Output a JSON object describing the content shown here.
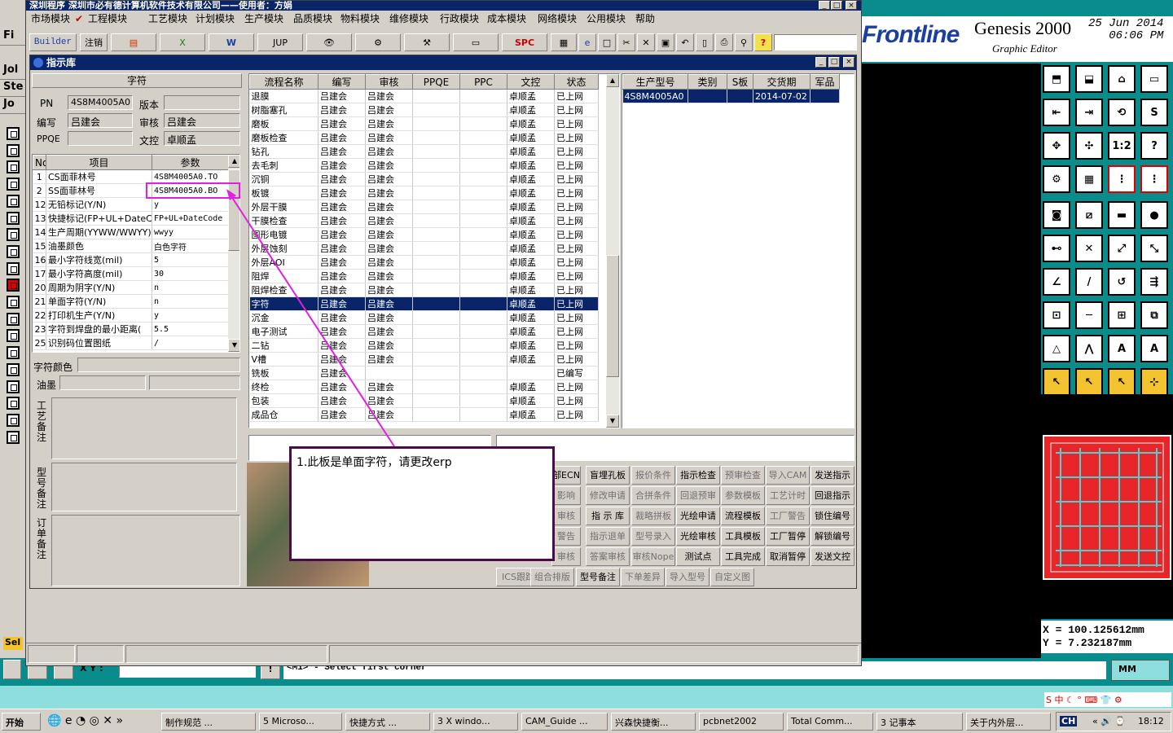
{
  "genesis": {
    "logo": "Frontline",
    "title": "Genesis 2000",
    "subtitle": "Graphic Editor",
    "date": "25 Jun 2014",
    "time": "06:06 PM",
    "coord_x": "X = 100.125612mm",
    "coord_y": "Y = 7.232187mm",
    "xy_label": "X Y :",
    "prompt": "<M1> - Select first corner",
    "units": "MM",
    "left_tabs": [
      "Fi",
      "Jol",
      "Ste",
      "Jo"
    ],
    "sel_label": "Sel"
  },
  "erp": {
    "title": "深圳程序     深圳市必有德计算机软件技术有限公司——使用者：方娟",
    "menu": [
      "市场模块",
      "工程模块",
      "工艺模块",
      "计划模块",
      "生产模块",
      "品质模块",
      "物料模块",
      "维修模块",
      "行政模块",
      "成本模块",
      "网络模块",
      "公用模块",
      "帮助"
    ],
    "toolbar": {
      "builder": "Builder",
      "logout": "注销",
      "jup": "JUP",
      "spc": "SPC"
    },
    "child_title": "指示库",
    "zifu_header": "字符",
    "pn_label": "PN",
    "pn_value": "4S8M4005A0",
    "version_label": "版本",
    "version_value": "",
    "author_label": "编写",
    "author_value": "吕建会",
    "review_label": "审核",
    "review_value": "吕建会",
    "ppqe_label": "PPQE",
    "ppqe_value": "",
    "doc_label": "文控",
    "doc_value": "卓顺孟",
    "param_headers": [
      "No",
      "项目",
      "参数"
    ],
    "params": [
      {
        "no": "1",
        "item": "CS面菲林号",
        "val": "4S8M4005A0.TO"
      },
      {
        "no": "2",
        "item": "SS面菲林号",
        "val": "4S8M4005A0.BO"
      },
      {
        "no": "12",
        "item": "无铅标记(Y/N)",
        "val": "y"
      },
      {
        "no": "13",
        "item": "快捷标记(FP+UL+DateCo",
        "val": "FP+UL+DateCode"
      },
      {
        "no": "14",
        "item": "生产周期(YYWW/WWYY)",
        "val": "wwyy"
      },
      {
        "no": "15",
        "item": "油墨颜色",
        "val": "白色字符"
      },
      {
        "no": "16",
        "item": "最小字符线宽(mil)",
        "val": "5"
      },
      {
        "no": "17",
        "item": "最小字符高度(mil)",
        "val": "30"
      },
      {
        "no": "20",
        "item": "周期为阴字(Y/N)",
        "val": "n"
      },
      {
        "no": "21",
        "item": "单面字符(Y/N)",
        "val": "n"
      },
      {
        "no": "22",
        "item": "打印机生产(Y/N)",
        "val": "y"
      },
      {
        "no": "23",
        "item": "字符到焊盘的最小距离(",
        "val": "5.5"
      },
      {
        "no": "25",
        "item": "识别码位置图纸",
        "val": "/"
      }
    ],
    "char_color_label": "字符颜色",
    "ink_label": "油墨",
    "craft_note_label": "工艺备注",
    "model_note_label": "型号备注",
    "order_note_label": "订单备注",
    "flow_headers": [
      "流程名称",
      "编写",
      "审核",
      "PPQE",
      "PPC",
      "文控",
      "状态"
    ],
    "flows": [
      {
        "n": "退膜",
        "a": "吕建会",
        "r": "吕建会",
        "d": "卓顺孟",
        "s": "已上网"
      },
      {
        "n": "树脂塞孔",
        "a": "吕建会",
        "r": "吕建会",
        "d": "卓顺孟",
        "s": "已上网"
      },
      {
        "n": "磨板",
        "a": "吕建会",
        "r": "吕建会",
        "d": "卓顺孟",
        "s": "已上网"
      },
      {
        "n": "磨板检查",
        "a": "吕建会",
        "r": "吕建会",
        "d": "卓顺孟",
        "s": "已上网"
      },
      {
        "n": "钻孔",
        "a": "吕建会",
        "r": "吕建会",
        "d": "卓顺孟",
        "s": "已上网"
      },
      {
        "n": "去毛刺",
        "a": "吕建会",
        "r": "吕建会",
        "d": "卓顺孟",
        "s": "已上网"
      },
      {
        "n": "沉铜",
        "a": "吕建会",
        "r": "吕建会",
        "d": "卓顺孟",
        "s": "已上网"
      },
      {
        "n": "板镀",
        "a": "吕建会",
        "r": "吕建会",
        "d": "卓顺孟",
        "s": "已上网"
      },
      {
        "n": "外层干膜",
        "a": "吕建会",
        "r": "吕建会",
        "d": "卓顺孟",
        "s": "已上网"
      },
      {
        "n": "干膜检查",
        "a": "吕建会",
        "r": "吕建会",
        "d": "卓顺孟",
        "s": "已上网"
      },
      {
        "n": "图形电镀",
        "a": "吕建会",
        "r": "吕建会",
        "d": "卓顺孟",
        "s": "已上网"
      },
      {
        "n": "外层蚀刻",
        "a": "吕建会",
        "r": "吕建会",
        "d": "卓顺孟",
        "s": "已上网"
      },
      {
        "n": "外层AOI",
        "a": "吕建会",
        "r": "吕建会",
        "d": "卓顺孟",
        "s": "已上网"
      },
      {
        "n": "阻焊",
        "a": "吕建会",
        "r": "吕建会",
        "d": "卓顺孟",
        "s": "已上网"
      },
      {
        "n": "阻焊检查",
        "a": "吕建会",
        "r": "吕建会",
        "d": "卓顺孟",
        "s": "已上网"
      },
      {
        "n": "字符",
        "a": "吕建会",
        "r": "吕建会",
        "d": "卓顺孟",
        "s": "已上网"
      },
      {
        "n": "沉金",
        "a": "吕建会",
        "r": "吕建会",
        "d": "卓顺孟",
        "s": "已上网"
      },
      {
        "n": "电子测试",
        "a": "吕建会",
        "r": "吕建会",
        "d": "卓顺孟",
        "s": "已上网"
      },
      {
        "n": "二钻",
        "a": "吕建会",
        "r": "吕建会",
        "d": "卓顺孟",
        "s": "已上网"
      },
      {
        "n": "V槽",
        "a": "吕建会",
        "r": "吕建会",
        "d": "卓顺孟",
        "s": "已上网"
      },
      {
        "n": "铣板",
        "a": "吕建会",
        "r": "",
        "d": "",
        "s": "已编写"
      },
      {
        "n": "终检",
        "a": "吕建会",
        "r": "吕建会",
        "d": "卓顺孟",
        "s": "已上网"
      },
      {
        "n": "包装",
        "a": "吕建会",
        "r": "吕建会",
        "d": "卓顺孟",
        "s": "已上网"
      },
      {
        "n": "成品仓",
        "a": "吕建会",
        "r": "吕建会",
        "d": "卓顺孟",
        "s": "已上网"
      }
    ],
    "model_headers": [
      "生产型号",
      "类别",
      "S板",
      "交货期",
      "军品"
    ],
    "model_row": {
      "model": "4S8M4005A0",
      "cat": "",
      "s": "",
      "due": "2014-07-02",
      "mil": ""
    },
    "buttons": [
      [
        "部ECN",
        "盲埋孔板",
        "报价条件",
        "指示检查",
        "预审检查",
        "导入CAM",
        "发送指示"
      ],
      [
        "影响",
        "修改申请",
        "合拼条件",
        "回退预审",
        "参数模板",
        "工艺计时",
        "回退指示"
      ],
      [
        "审核",
        "指 示 库",
        "裁略拼板",
        "光绘申请",
        "流程模板",
        "工厂警告",
        "锁住编号"
      ],
      [
        "警告",
        "指示退单",
        "型号录入",
        "光绘审核",
        "工具模板",
        "工厂暂停",
        "解锁编号"
      ],
      [
        "审核",
        "答案审核",
        "审核Nope",
        "测试点",
        "工具完成",
        "取消暂停",
        "发送文控"
      ],
      [
        "ICS跟踪",
        "组合排版",
        "型号备注",
        "下单差异",
        "导入型号",
        "自定义图",
        ""
      ]
    ],
    "note": "1.此板是单面字符，请更改erp"
  },
  "taskbar": {
    "start": "开始",
    "items": [
      "制作规范 ...",
      "5 Microso...",
      "快捷方式 ...",
      "3 X windo...",
      "CAM_Guide ...",
      "兴森快捷衡...",
      "pcbnet2002",
      "Total Comm...",
      "3 记事本",
      "关于内外层..."
    ],
    "lang": "CH",
    "clock": "18:12"
  }
}
